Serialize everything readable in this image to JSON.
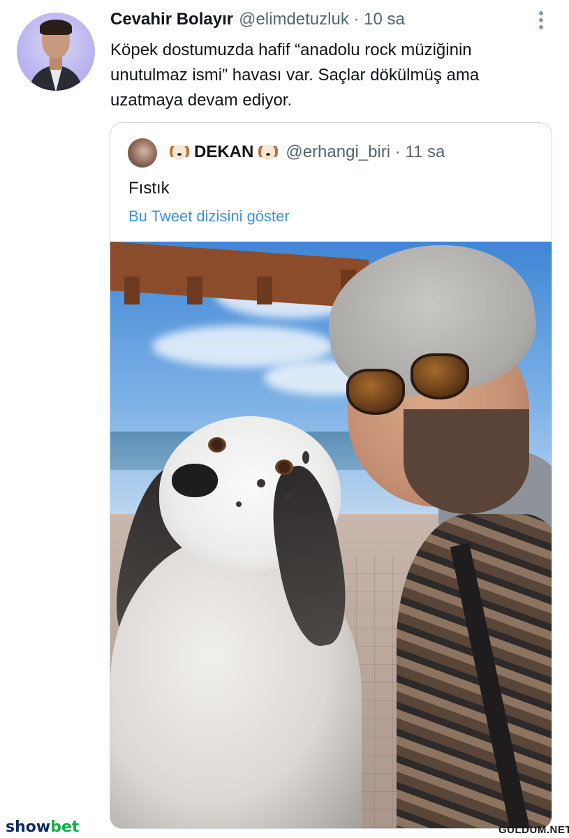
{
  "tweet": {
    "author_name": "Cevahir Bolayır",
    "meta": "@elimdetuzluk · 10 sa",
    "text": "Köpek dostumuzda hafif “anadolu rock müziğinin unutulmaz ismi” havası var. Saçlar dökülmüş ama uzatmaya devam ediyor.",
    "more_icon": "more-options-vertical-icon"
  },
  "quoted_tweet": {
    "author_name": "DEKAN",
    "emoji_icon": "dog-face-emoji",
    "meta": "@erhangi_biri · 11 sa",
    "text": "Fıstık",
    "thread_link": "Bu Tweet dizisini göster"
  },
  "watermarks": {
    "left_a": "show",
    "left_b": "bet",
    "right": "GULDUM.NET"
  },
  "colors": {
    "link": "#3b94d9",
    "secondary_text": "#536471",
    "border": "#cfd9de"
  }
}
